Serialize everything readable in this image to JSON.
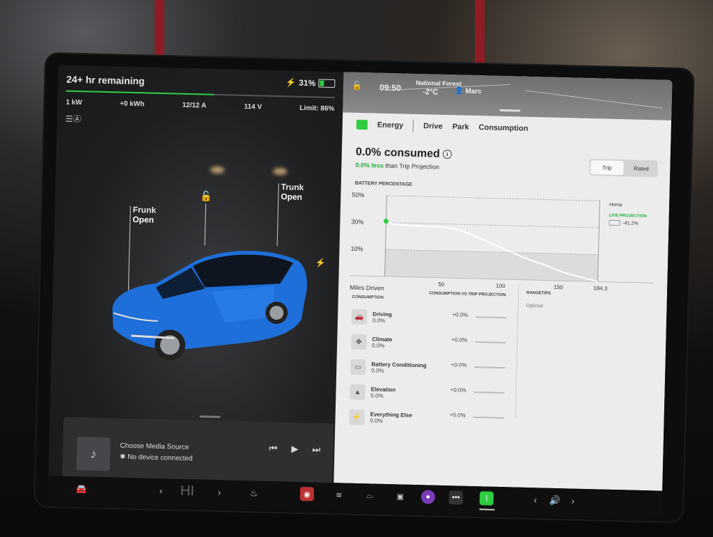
{
  "status": {
    "range": "24+ hr remaining",
    "battery_pct": "31%",
    "battery_fraction": 0.31,
    "charge_progress": 0.55,
    "power": "1 kW",
    "energy_added": "+0 kWh",
    "current": "12/12 A",
    "voltage": "114 V",
    "limit": "Limit: 86%"
  },
  "car": {
    "frunk_title": "Frunk",
    "frunk_state": "Open",
    "trunk_title": "Trunk",
    "trunk_state": "Open",
    "body_color": "#1e6fd9"
  },
  "media": {
    "title": "Choose Media Source",
    "subtitle": "No device connected"
  },
  "map": {
    "time": "09:50",
    "temp": "-2°C",
    "place": "National Forest",
    "user": "Marc"
  },
  "energy": {
    "app_label": "Energy",
    "tabs": [
      "Drive",
      "Park",
      "Consumption"
    ],
    "consumed": "0.0% consumed",
    "trip_delta": "0.0% less",
    "trip_suffix": " than Trip Projection",
    "toggle": [
      "Trip",
      "Rated"
    ],
    "battery_label": "BATTERY PERCENTAGE",
    "legend_home": "Home",
    "legend_projection": "LIVE PROJECTION",
    "legend_value": "-41.2%",
    "consumption_header": "CONSUMPTION",
    "cvt_header": "CONSUMPTION VS TRIP PROJECTION",
    "rangetips_header": "RANGETIPS",
    "rangetips_value": "Optimal",
    "categories": [
      {
        "name": "Driving",
        "value": "0.0%",
        "delta": "+0.0%",
        "icon": "car-icon"
      },
      {
        "name": "Climate",
        "value": "0.0%",
        "delta": "+0.0%",
        "icon": "fan-icon"
      },
      {
        "name": "Battery Conditioning",
        "value": "0.0%",
        "delta": "+0.0%",
        "icon": "battery-icon"
      },
      {
        "name": "Elevation",
        "value": "0.0%",
        "delta": "+0.0%",
        "icon": "mountain-icon"
      },
      {
        "name": "Everything Else",
        "value": "0.0%",
        "delta": "+0.0%",
        "icon": "bolt-icon"
      }
    ]
  },
  "chart_data": {
    "type": "line",
    "title": "",
    "xlabel": "Miles Driven",
    "ylabel": "",
    "x_ticks": [
      50,
      100,
      150,
      184.3
    ],
    "y_ticks": [
      "50%",
      "30%",
      "10%"
    ],
    "xlim": [
      0,
      184.3
    ],
    "ylim": [
      -10,
      50
    ],
    "series": [
      {
        "x": [
          0,
          5,
          10,
          20,
          30,
          40,
          50,
          60,
          70,
          80,
          90,
          100,
          110,
          120,
          130,
          140,
          150,
          160,
          170,
          184.3
        ],
        "y": [
          31,
          29,
          28.8,
          28.2,
          28,
          27.8,
          27.5,
          26.5,
          24,
          20.5,
          17,
          13.5,
          10,
          6.5,
          3.5,
          1,
          -2.5,
          -5,
          -7,
          -10
        ]
      }
    ],
    "grid": true
  },
  "dock": {
    "speed": "HI",
    "colors": {
      "accent": "#2ecc40"
    }
  }
}
